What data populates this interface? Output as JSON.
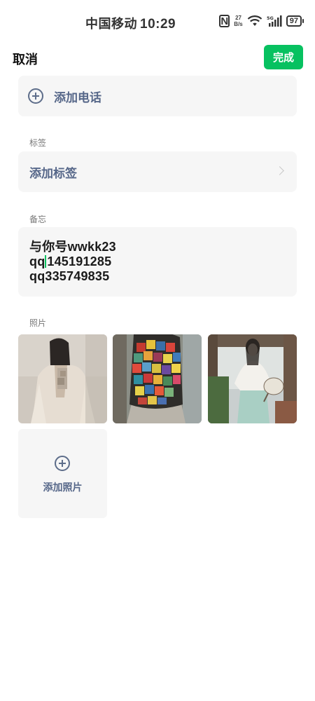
{
  "status_bar": {
    "carrier": "中国移动",
    "time": "10:29",
    "nfc": "N",
    "speed_value": "27",
    "speed_unit": "B/s",
    "network": "5G",
    "battery": "97"
  },
  "nav": {
    "cancel_label": "取消",
    "done_label": "完成"
  },
  "phone": {
    "add_label": "添加电话"
  },
  "tags": {
    "section_title": "标签",
    "add_label": "添加标签"
  },
  "notes": {
    "section_title": "备忘",
    "line1": "与你号wwkk23",
    "line2_before_cursor": "qq",
    "line2_after_cursor": "145191285",
    "line3": "qq335749835"
  },
  "photos": {
    "section_title": "照片",
    "add_label": "添加照片",
    "count": 3
  },
  "colors": {
    "accent_green": "#07c160",
    "link_blue_gray": "#566789",
    "card_bg": "#f6f6f6"
  }
}
